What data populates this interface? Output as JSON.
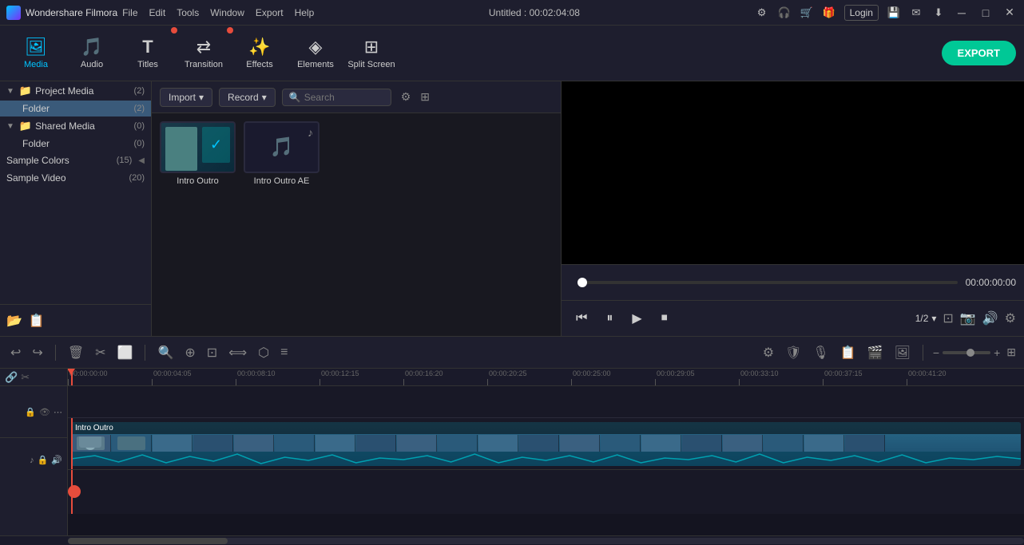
{
  "app": {
    "name": "Wondershare Filmora",
    "logo_alt": "Filmora Logo",
    "title_bar": "Untitled : 00:02:04:08",
    "menu": [
      "File",
      "Edit",
      "Tools",
      "Window",
      "Export",
      "Help"
    ]
  },
  "toolbar": {
    "items": [
      {
        "id": "media",
        "label": "Media",
        "icon": "🖼",
        "active": true,
        "badge": false
      },
      {
        "id": "audio",
        "label": "Audio",
        "icon": "🎵",
        "active": false,
        "badge": false
      },
      {
        "id": "titles",
        "label": "Titles",
        "icon": "T",
        "active": false,
        "badge": true
      },
      {
        "id": "transition",
        "label": "Transition",
        "icon": "↔",
        "active": false,
        "badge": true
      },
      {
        "id": "effects",
        "label": "Effects",
        "icon": "✨",
        "active": false,
        "badge": false
      },
      {
        "id": "elements",
        "label": "Elements",
        "icon": "◆",
        "active": false,
        "badge": false
      },
      {
        "id": "split_screen",
        "label": "Split Screen",
        "icon": "⊞",
        "active": false,
        "badge": false
      }
    ],
    "export_label": "EXPORT"
  },
  "left_panel": {
    "sections": [
      {
        "label": "Project Media",
        "count": "(2)",
        "expanded": true,
        "selected": true,
        "children": [
          {
            "label": "Folder",
            "count": "(2)",
            "selected": true
          }
        ]
      },
      {
        "label": "Shared Media",
        "count": "(0)",
        "expanded": true,
        "selected": false,
        "children": [
          {
            "label": "Folder",
            "count": "(0)",
            "selected": false
          }
        ]
      }
    ],
    "simple_items": [
      {
        "label": "Sample Colors",
        "count": "(15)"
      },
      {
        "label": "Sample Video",
        "count": "(20)"
      }
    ],
    "footer_icons": [
      "📁",
      "📋"
    ]
  },
  "media_panel": {
    "import_label": "Import",
    "record_label": "Record",
    "search_placeholder": "Search",
    "items": [
      {
        "id": "intro_outro",
        "label": "Intro Outro",
        "type": "video"
      },
      {
        "id": "intro_outro_ae",
        "label": "Intro Outro AE",
        "type": "audio"
      }
    ]
  },
  "preview": {
    "time_current": "00:00:00:00",
    "page_indicator": "1/2",
    "controls": {
      "rewind": "⏮",
      "play_pause": "⏸",
      "play": "▶",
      "stop": "⏹"
    }
  },
  "timeline": {
    "tools": [
      "↩",
      "↪",
      "🗑",
      "✂",
      "⬜",
      "🔍",
      "⊕",
      "⊡",
      "⟺",
      "⬡",
      "≡"
    ],
    "ruler_marks": [
      "00:00:00:00",
      "00:00:04:05",
      "00:00:08:10",
      "00:00:12:15",
      "00:00:16:20",
      "00:00:20:25",
      "00:00:25:00",
      "00:00:29:05",
      "00:00:33:10",
      "00:00:37:15",
      "00:00:41:20"
    ],
    "clip_label": "Intro Outro",
    "zoom_level": 50
  },
  "colors": {
    "accent": "#00c4ff",
    "export_green": "#00c896",
    "badge_red": "#e74c3c",
    "playhead_red": "#e74c3c",
    "bg_dark": "#1a1a2e",
    "bg_panel": "#1e1e2e",
    "clip_blue": "#2a6a8a"
  }
}
